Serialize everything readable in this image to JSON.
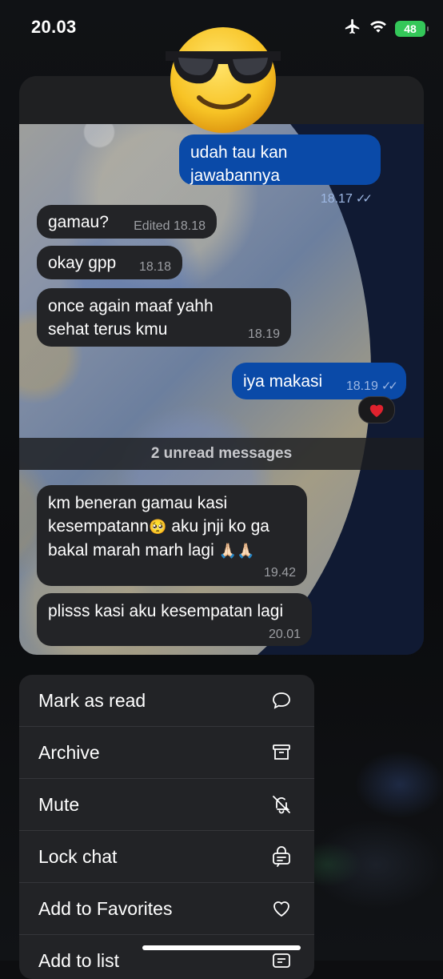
{
  "status_bar": {
    "time": "20.03",
    "battery": "48"
  },
  "chat": {
    "messages": [
      {
        "direction": "out",
        "text": "udah tau kan jawabannya",
        "time": "18.17",
        "read": true
      },
      {
        "direction": "in",
        "text": "gamau?",
        "edited": "Edited",
        "time": "18.18"
      },
      {
        "direction": "in",
        "text": "okay gpp",
        "time": "18.18"
      },
      {
        "direction": "in",
        "text_line1": "once again maaf yahh",
        "text_line2": "sehat terus kmu",
        "time": "18.19"
      },
      {
        "direction": "out",
        "text": "iya makasi",
        "time": "18.19",
        "read": true,
        "reaction": "heart"
      },
      {
        "direction": "in",
        "text_line1": "km beneran gamau kasi",
        "text_line2": "kesempatann",
        "text_line2b": " aku jnji ko ga",
        "text_line3": "bakal marah marh lagi ",
        "time": "19.42"
      },
      {
        "direction": "in",
        "text": "plisss kasi aku kesempatan lagi",
        "time": "20.01"
      }
    ],
    "unread_label": "2 unread messages"
  },
  "menu": {
    "items": [
      {
        "label": "Mark as read",
        "icon": "speech-bubble-icon"
      },
      {
        "label": "Archive",
        "icon": "archive-box-icon"
      },
      {
        "label": "Mute",
        "icon": "bell-slash-icon"
      },
      {
        "label": "Lock chat",
        "icon": "lock-chat-icon"
      },
      {
        "label": "Add to Favorites",
        "icon": "heart-outline-icon"
      },
      {
        "label": "Add to list",
        "icon": "add-list-icon"
      }
    ]
  },
  "colors": {
    "outgoing_bubble": "#0a4aa8",
    "incoming_bubble": "#232427",
    "battery": "#34c759",
    "reaction_heart": "#e0222e"
  }
}
